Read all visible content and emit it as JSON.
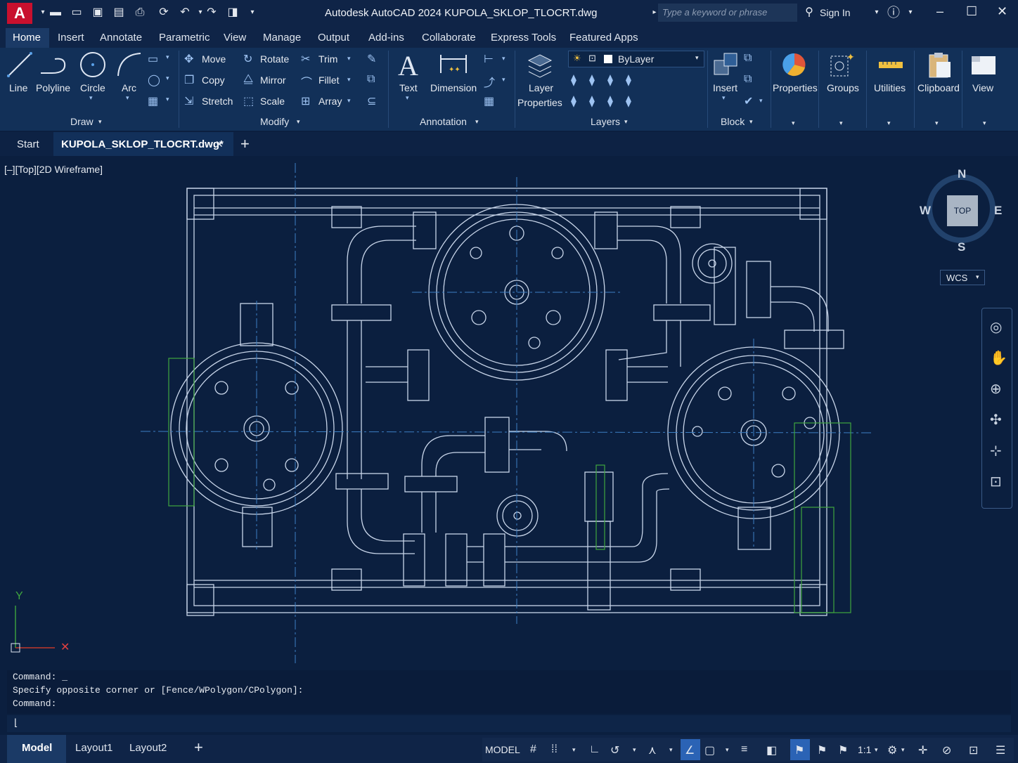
{
  "titlebar": {
    "app_logo": "A",
    "title": "Autodesk AutoCAD 2024    KUPOLA_SKLOP_TLOCRT.dwg",
    "search_placeholder": "Type a keyword or phrase",
    "sign_in": "Sign In"
  },
  "menu_tabs": [
    "Home",
    "Insert",
    "Annotate",
    "Parametric",
    "View",
    "Manage",
    "Output",
    "Add-ins",
    "Collaborate",
    "Express Tools",
    "Featured Apps"
  ],
  "ribbon": {
    "draw": {
      "line": "Line",
      "polyline": "Polyline",
      "circle": "Circle",
      "arc": "Arc",
      "panel": "Draw"
    },
    "modify": {
      "move": "Move",
      "rotate": "Rotate",
      "trim": "Trim",
      "copy": "Copy",
      "mirror": "Mirror",
      "fillet": "Fillet",
      "stretch": "Stretch",
      "scale": "Scale",
      "array": "Array",
      "panel": "Modify"
    },
    "annotation": {
      "text": "Text",
      "dimension": "Dimension",
      "panel": "Annotation"
    },
    "layers": {
      "layer_properties_1": "Layer",
      "layer_properties_2": "Properties",
      "layer_value": "ByLayer",
      "panel": "Layers"
    },
    "block": {
      "insert": "Insert",
      "panel": "Block"
    },
    "properties": "Properties",
    "groups": "Groups",
    "utilities": "Utilities",
    "clipboard": "Clipboard",
    "view": "View"
  },
  "file_tabs": {
    "start": "Start",
    "active": "KUPOLA_SKLOP_TLOCRT.dwg*",
    "close": "✕",
    "new": "+"
  },
  "viewport": {
    "label": "[–][Top][2D Wireframe]",
    "compass": {
      "n": "N",
      "s": "S",
      "e": "E",
      "w": "W",
      "top": "TOP"
    },
    "ucs": "WCS",
    "axis_y": "Y"
  },
  "command": {
    "history": [
      "Command: _",
      "Specify opposite corner or [Fence/WPolygon/CPolygon]:",
      "Command:"
    ],
    "input": ""
  },
  "status": {
    "layout_tabs": [
      "Model",
      "Layout1",
      "Layout2"
    ],
    "add_layout": "+",
    "model": "MODEL",
    "scale": "1:1"
  },
  "colors": {
    "background": "#0b1f3f",
    "drawing": "#c9d6ea",
    "center": "#3c7fc4",
    "green": "#3fa63f"
  }
}
